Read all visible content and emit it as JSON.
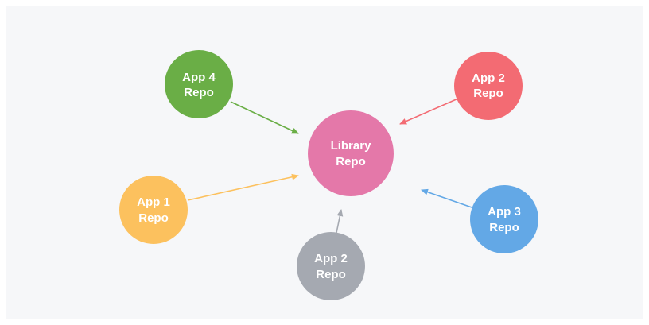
{
  "colors": {
    "background": "#f6f7f9",
    "library": "#e478a9",
    "app4": "#6aae46",
    "app2_top": "#f36b73",
    "app1": "#fcc15e",
    "app2_bottom": "#a5a9b1",
    "app3": "#63a8e6"
  },
  "nodes": {
    "library": {
      "line1": "Library",
      "line2": "Repo"
    },
    "app4": {
      "line1": "App 4",
      "line2": "Repo"
    },
    "app2_top": {
      "line1": "App 2",
      "line2": "Repo"
    },
    "app1": {
      "line1": "App 1",
      "line2": "Repo"
    },
    "app2_bottom": {
      "line1": "App 2",
      "line2": "Repo"
    },
    "app3": {
      "line1": "App 3",
      "line2": "Repo"
    }
  },
  "edges": [
    {
      "from": "app4",
      "to": "library"
    },
    {
      "from": "app2_top",
      "to": "library"
    },
    {
      "from": "app1",
      "to": "library"
    },
    {
      "from": "app2_bottom",
      "to": "library"
    },
    {
      "from": "app3",
      "to": "library"
    }
  ]
}
